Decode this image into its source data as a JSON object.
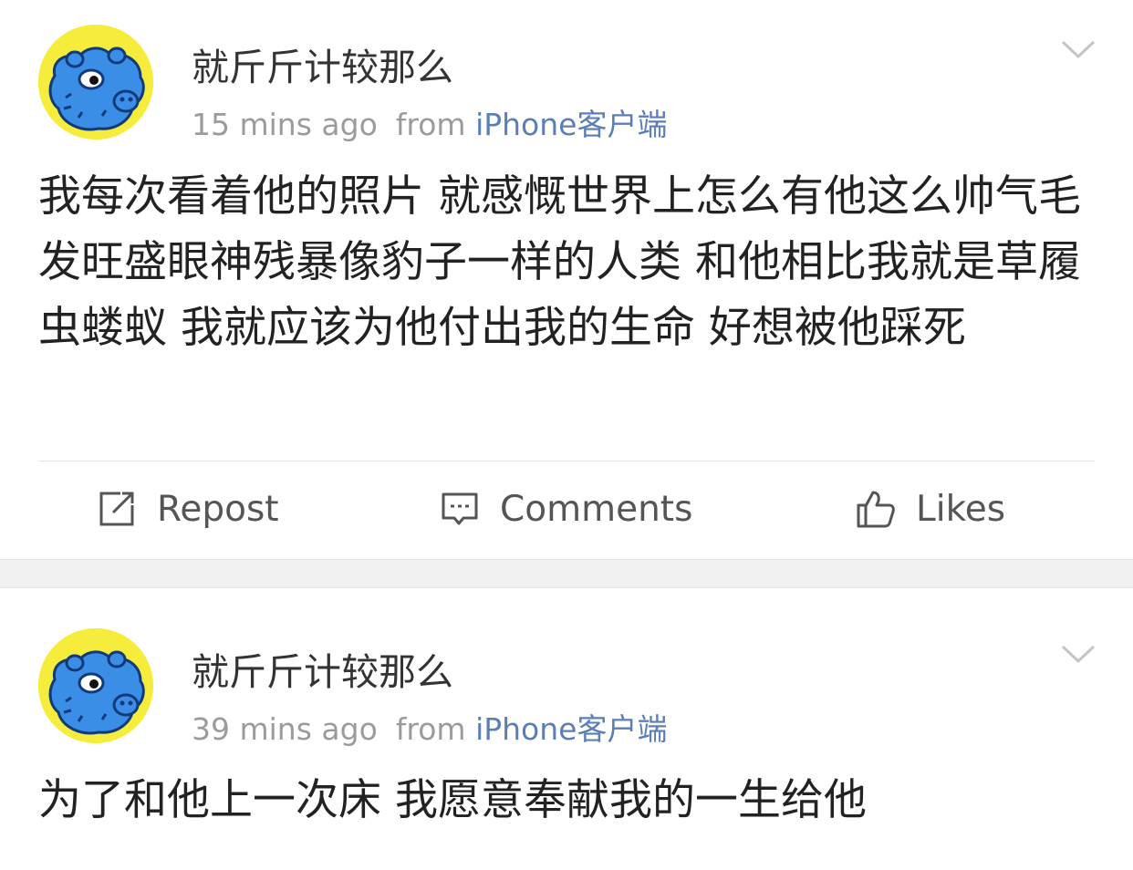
{
  "posts": [
    {
      "username": "就斤斤计较那么",
      "time": "15 mins ago",
      "from_label": "from",
      "source": "iPhone客户端",
      "content": "我每次看着他的照片 就感慨世界上怎么有他这么帅气毛发旺盛眼神残暴像豹子一样的人类 和他相比我就是草履虫蝼蚁 我就应该为他付出我的生命 好想被他踩死",
      "actions": {
        "repost": "Repost",
        "comments": "Comments",
        "likes": "Likes"
      }
    },
    {
      "username": "就斤斤计较那么",
      "time": "39 mins ago",
      "from_label": "from",
      "source": "iPhone客户端",
      "content": "为了和他上一次床 我愿意奉献我的一生给他"
    }
  ],
  "icons": {
    "avatar": "blue-hippo-cartoon-avatar",
    "menu": "chevron-down-icon",
    "repost": "repost-icon",
    "comments": "comment-icon",
    "likes": "thumbs-up-icon"
  },
  "colors": {
    "source_link": "#5b7fb5",
    "meta": "#9b9b9b",
    "avatar_bg": "#f5ec3c",
    "separator": "#f1f1f1"
  }
}
